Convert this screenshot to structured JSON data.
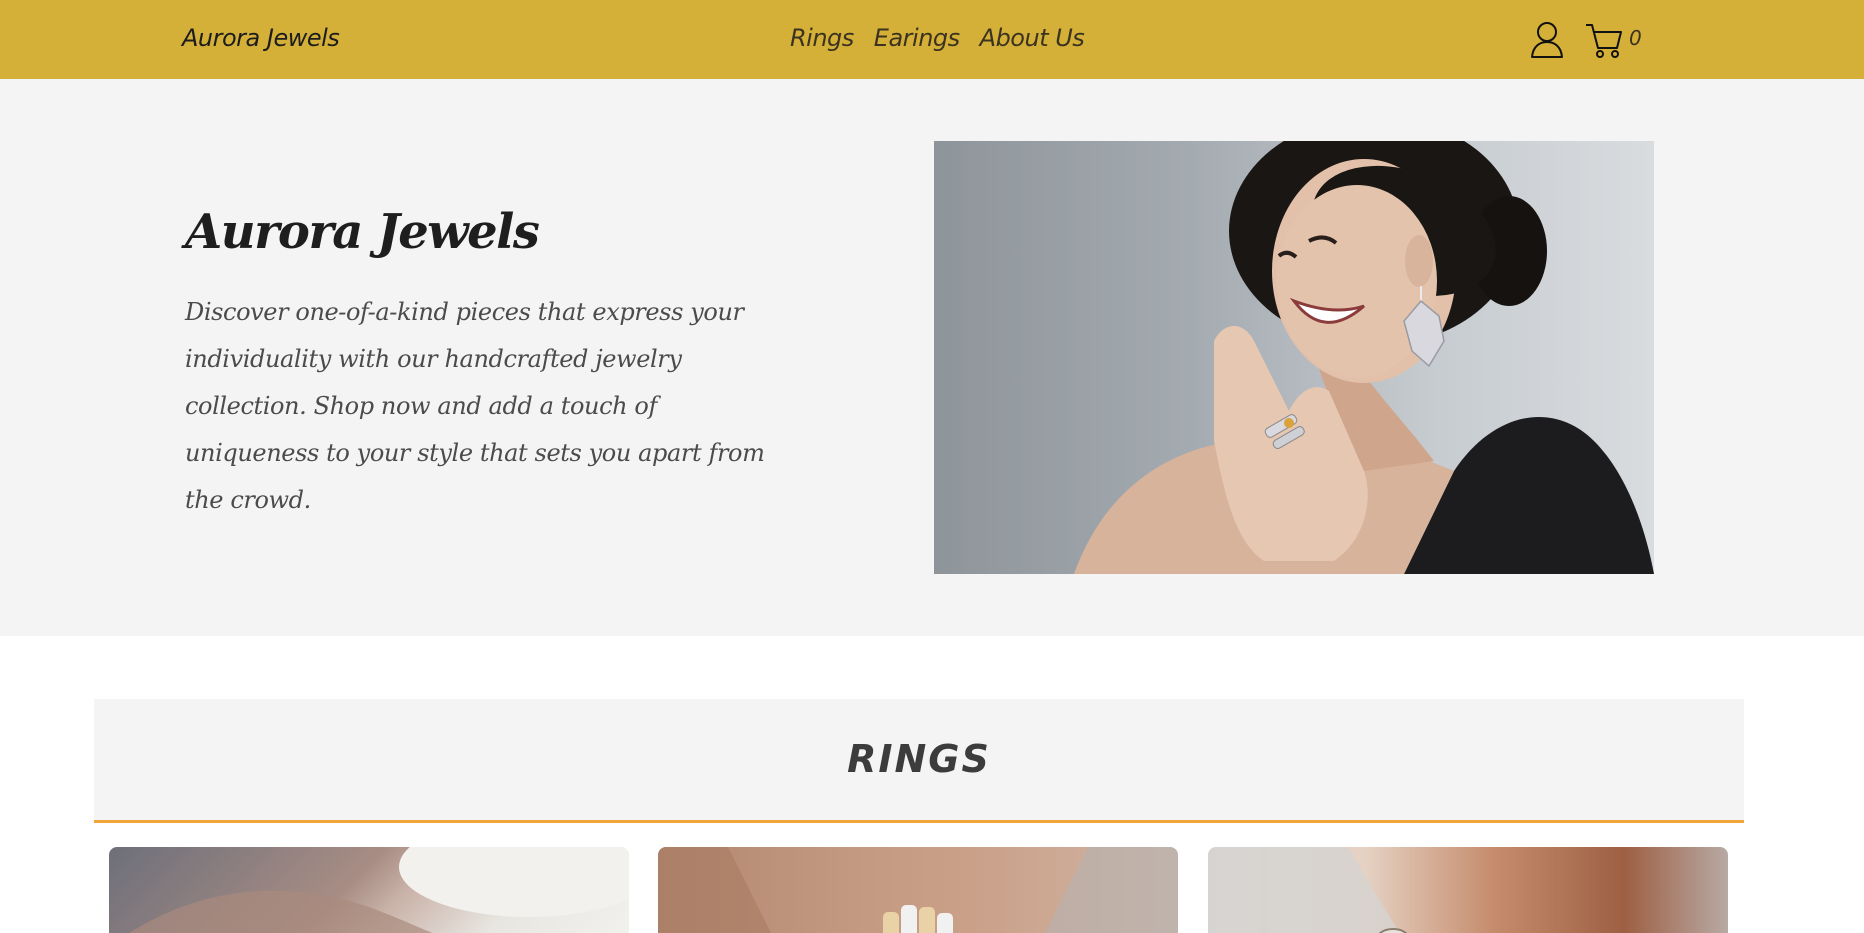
{
  "header": {
    "brand": "Aurora Jewels",
    "nav": [
      "Rings",
      "Earings",
      "About Us"
    ],
    "cart_count": "0",
    "background": "#d4b038"
  },
  "hero": {
    "title": "Aurora Jewels",
    "text": "Discover one-of-a-kind pieces that express your individuality with our handcrafted jewelry collection. Shop now and add a touch of uniqueness to your style that sets you apart from the crowd.",
    "photo": "woman-with-earring-and-rings-photo"
  },
  "rings": {
    "title": "RINGS",
    "accent": "#f0a43a",
    "cards": [
      "ring-photo-1",
      "ring-photo-2",
      "ring-photo-3"
    ]
  }
}
